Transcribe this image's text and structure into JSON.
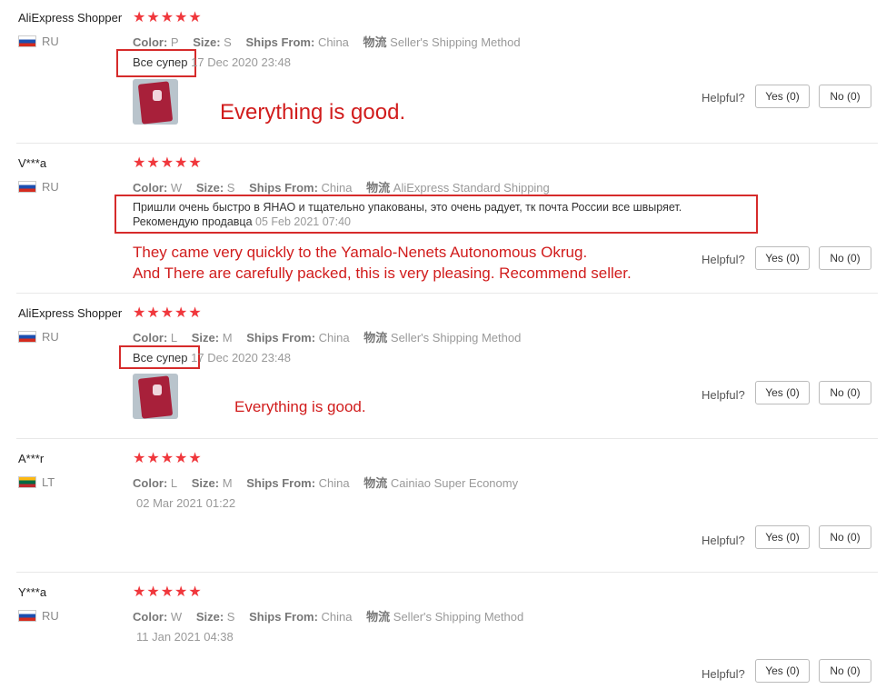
{
  "reviews": [
    {
      "user": "AliExpress Shopper",
      "country": "RU",
      "stars": "★★★★★",
      "attrs": [
        {
          "key": "Color:",
          "value": "P"
        },
        {
          "key": "Size:",
          "value": "S"
        },
        {
          "key": "Ships From:",
          "value": "China"
        },
        {
          "key": "物流",
          "value": "Seller's Shipping Method"
        }
      ],
      "feedback": "Все супер",
      "date": "17 Dec 2020 23:48",
      "translation": "Everything is good.",
      "helpful_label": "Helpful?",
      "yes_label": "Yes (0)",
      "no_label": "No (0)"
    },
    {
      "user": "V***a",
      "country": "RU",
      "stars": "★★★★★",
      "attrs": [
        {
          "key": "Color:",
          "value": "W"
        },
        {
          "key": "Size:",
          "value": "S"
        },
        {
          "key": "Ships From:",
          "value": "China"
        },
        {
          "key": "物流",
          "value": "AliExpress Standard Shipping"
        }
      ],
      "feedback_line1": "Пришли очень быстро в ЯНАО и тщательно упакованы, это очень радует, тк почта России все швыряет.",
      "feedback_line2": "Рекомендую продавца",
      "date": "05 Feb 2021 07:40",
      "translation_line1": "They came very quickly to the Yamalo-Nenets Autonomous Okrug.",
      "translation_line2": "And There are carefully packed, this is very pleasing. Recommend seller.",
      "helpful_label": "Helpful?",
      "yes_label": "Yes (0)",
      "no_label": "No (0)"
    },
    {
      "user": "AliExpress Shopper",
      "country": "RU",
      "stars": "★★★★★",
      "attrs": [
        {
          "key": "Color:",
          "value": "L"
        },
        {
          "key": "Size:",
          "value": "M"
        },
        {
          "key": "Ships From:",
          "value": "China"
        },
        {
          "key": "物流",
          "value": "Seller's Shipping Method"
        }
      ],
      "feedback": "Все супер",
      "date": "17 Dec 2020 23:48",
      "translation": "Everything is good.",
      "helpful_label": "Helpful?",
      "yes_label": "Yes (0)",
      "no_label": "No (0)"
    },
    {
      "user": "A***r",
      "country": "LT",
      "stars": "★★★★★",
      "attrs": [
        {
          "key": "Color:",
          "value": "L"
        },
        {
          "key": "Size:",
          "value": "M"
        },
        {
          "key": "Ships From:",
          "value": "China"
        },
        {
          "key": "物流",
          "value": "Cainiao Super Economy"
        }
      ],
      "date": "02 Mar 2021 01:22",
      "helpful_label": "Helpful?",
      "yes_label": "Yes (0)",
      "no_label": "No (0)"
    },
    {
      "user": "Y***a",
      "country": "RU",
      "stars": "★★★★★",
      "attrs": [
        {
          "key": "Color:",
          "value": "W"
        },
        {
          "key": "Size:",
          "value": "S"
        },
        {
          "key": "Ships From:",
          "value": "China"
        },
        {
          "key": "物流",
          "value": "Seller's Shipping Method"
        }
      ],
      "date": "11 Jan 2021 04:38",
      "helpful_label": "Helpful?",
      "yes_label": "Yes (0)",
      "no_label": "No (0)"
    }
  ]
}
